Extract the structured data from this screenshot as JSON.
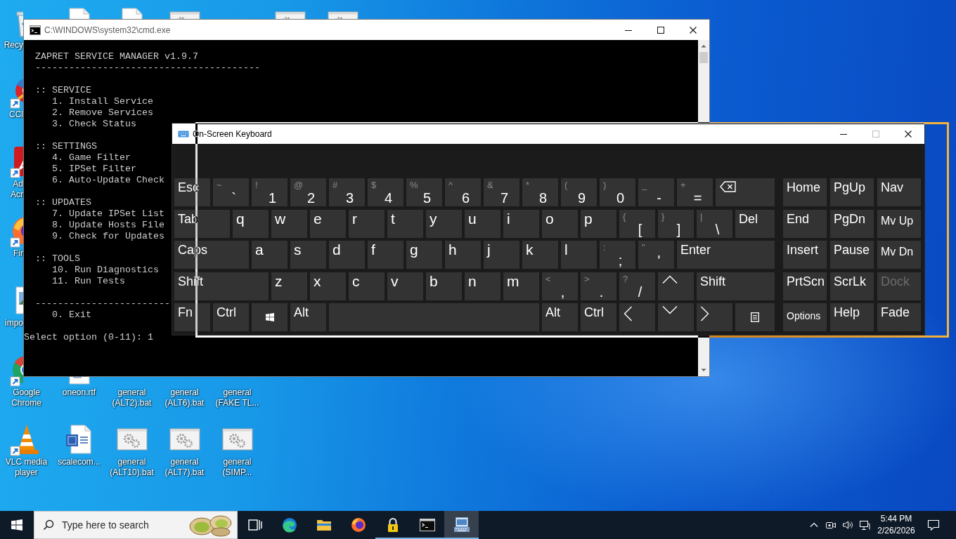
{
  "desktop": {
    "icons": [
      {
        "kind": "bin",
        "label": "Recy"
      },
      {
        "kind": "cleaner",
        "label": "CCl"
      },
      {
        "kind": "pdf",
        "label": "Ad Acr"
      },
      {
        "kind": "fox",
        "label": "Fir"
      },
      {
        "kind": "image",
        "label": "impo"
      },
      {
        "kind": "chrome",
        "label": "Google Chrome"
      },
      {
        "kind": "cone",
        "label": "VLC media player"
      },
      {
        "kind": "document"
      },
      {
        "kind": "document",
        "label": "oneon.rtf"
      },
      {
        "kind": "word",
        "label": "scalecom..."
      },
      {
        "kind": "document"
      },
      {
        "kind": "batch",
        "label": "general (ALT2).bat"
      },
      {
        "kind": "batch",
        "label": "general (ALT10).bat"
      },
      {
        "kind": "batch"
      },
      {
        "kind": "batch",
        "label": "general (ALT6).bat"
      },
      {
        "kind": "batch",
        "label": "general (ALT7).bat"
      },
      {
        "kind": "batch",
        "label": "general (FAKE TL..."
      },
      {
        "kind": "batch",
        "label": "general (SIMP..."
      },
      {
        "kind": "batch"
      },
      {
        "kind": "batch"
      }
    ]
  },
  "terminal_window": {
    "title": "C:\\WINDOWS\\system32\\cmd.exe",
    "controls": [
      {
        "kind": "minimize",
        "disabled": false
      },
      {
        "kind": "maximize",
        "disabled": false
      },
      {
        "kind": "close",
        "disabled": false
      }
    ],
    "console": {
      "header": "ZAPRET SERVICE MANAGER v1.9.7",
      "rule": "----------------------------------------",
      "sections": [
        {
          "heading": ":: SERVICE",
          "items": [
            "1. Install Service",
            "2. Remove Services",
            "3. Check Status"
          ]
        },
        {
          "heading": ":: SETTINGS",
          "items": [
            "4. Game Filter",
            "5. IPSet Filter",
            "6. Auto-Update Check"
          ]
        },
        {
          "heading": ":: UPDATES",
          "items": [
            "7. Update IPSet List",
            "8. Update Hosts File",
            "9. Check for Updates"
          ]
        },
        {
          "heading": ":: TOOLS",
          "items": [
            "10. Run Diagnostics",
            "11. Run Tests"
          ]
        }
      ],
      "footer_rule": "------------------------",
      "exit_item": "0. Exit",
      "prompt": "Select option (0-11): 1"
    }
  },
  "keyboard_window": {
    "title": "On-Screen Keyboard",
    "dragging": true,
    "controls": [
      {
        "kind": "minimize",
        "disabled": false
      },
      {
        "kind": "maximize",
        "disabled": true
      },
      {
        "kind": "close",
        "disabled": false
      }
    ],
    "main_rows": [
      [
        {
          "kind": "text",
          "label": "Esc"
        },
        {
          "kind": "dual",
          "shift": "~",
          "label": "`"
        },
        {
          "kind": "dual",
          "shift": "!",
          "label": "1"
        },
        {
          "kind": "dual",
          "shift": "@",
          "label": "2"
        },
        {
          "kind": "dual",
          "shift": "#",
          "label": "3"
        },
        {
          "kind": "dual",
          "shift": "$",
          "label": "4"
        },
        {
          "kind": "dual",
          "shift": "%",
          "label": "5"
        },
        {
          "kind": "dual",
          "shift": "^",
          "label": "6"
        },
        {
          "kind": "dual",
          "shift": "&",
          "label": "7"
        },
        {
          "kind": "dual",
          "shift": "*",
          "label": "8"
        },
        {
          "kind": "dual",
          "shift": "(",
          "label": "9"
        },
        {
          "kind": "dual",
          "shift": ")",
          "label": "0"
        },
        {
          "kind": "dual",
          "shift": "_",
          "label": "-"
        },
        {
          "kind": "dual",
          "shift": "+",
          "label": "="
        },
        {
          "kind": "backspace"
        }
      ],
      [
        {
          "kind": "text",
          "label": "Tab"
        },
        {
          "kind": "letter",
          "label": "q"
        },
        {
          "kind": "letter",
          "label": "w"
        },
        {
          "kind": "letter",
          "label": "e"
        },
        {
          "kind": "letter",
          "label": "r"
        },
        {
          "kind": "letter",
          "label": "t"
        },
        {
          "kind": "letter",
          "label": "y"
        },
        {
          "kind": "letter",
          "label": "u"
        },
        {
          "kind": "letter",
          "label": "i"
        },
        {
          "kind": "letter",
          "label": "o"
        },
        {
          "kind": "letter",
          "label": "p"
        },
        {
          "kind": "dual",
          "shift": "{",
          "label": "["
        },
        {
          "kind": "dual",
          "shift": "}",
          "label": "]"
        },
        {
          "kind": "dual",
          "shift": "|",
          "label": "\\"
        },
        {
          "kind": "text",
          "label": "Del"
        }
      ],
      [
        {
          "kind": "text",
          "label": "Caps"
        },
        {
          "kind": "letter",
          "label": "a"
        },
        {
          "kind": "letter",
          "label": "s"
        },
        {
          "kind": "letter",
          "label": "d"
        },
        {
          "kind": "letter",
          "label": "f"
        },
        {
          "kind": "letter",
          "label": "g"
        },
        {
          "kind": "letter",
          "label": "h"
        },
        {
          "kind": "letter",
          "label": "j"
        },
        {
          "kind": "letter",
          "label": "k"
        },
        {
          "kind": "letter",
          "label": "l"
        },
        {
          "kind": "dual",
          "shift": ":",
          "label": ";"
        },
        {
          "kind": "dual",
          "shift": "\"",
          "label": "'"
        },
        {
          "kind": "text",
          "label": "Enter"
        }
      ],
      [
        {
          "kind": "text",
          "label": "Shift"
        },
        {
          "kind": "letter",
          "label": "z"
        },
        {
          "kind": "letter",
          "label": "x"
        },
        {
          "kind": "letter",
          "label": "c"
        },
        {
          "kind": "letter",
          "label": "v"
        },
        {
          "kind": "letter",
          "label": "b"
        },
        {
          "kind": "letter",
          "label": "n"
        },
        {
          "kind": "letter",
          "label": "m"
        },
        {
          "kind": "dual",
          "shift": "<",
          "label": ","
        },
        {
          "kind": "dual",
          "shift": ">",
          "label": "."
        },
        {
          "kind": "dual",
          "shift": "?",
          "label": "/"
        },
        {
          "kind": "up"
        },
        {
          "kind": "text",
          "label": "Shift"
        }
      ],
      [
        {
          "kind": "text",
          "label": "Fn"
        },
        {
          "kind": "text",
          "label": "Ctrl"
        },
        {
          "kind": "windows"
        },
        {
          "kind": "text",
          "label": "Alt"
        },
        {
          "kind": "space"
        },
        {
          "kind": "text",
          "label": "Alt"
        },
        {
          "kind": "text",
          "label": "Ctrl"
        },
        {
          "kind": "left"
        },
        {
          "kind": "down"
        },
        {
          "kind": "right"
        },
        {
          "kind": "menu"
        }
      ]
    ],
    "side_rows": [
      [
        {
          "kind": "text",
          "label": "Home",
          "disabled": false
        },
        {
          "kind": "text",
          "label": "PgUp",
          "disabled": false
        },
        {
          "kind": "text",
          "label": "Nav",
          "disabled": false
        }
      ],
      [
        {
          "kind": "text",
          "label": "End",
          "disabled": false
        },
        {
          "kind": "text",
          "label": "PgDn",
          "disabled": false
        },
        {
          "kind": "compact",
          "label": "Mv Up",
          "disabled": false
        }
      ],
      [
        {
          "kind": "text",
          "label": "Insert",
          "disabled": false
        },
        {
          "kind": "text",
          "label": "Pause",
          "disabled": false
        },
        {
          "kind": "compact",
          "label": "Mv Dn",
          "disabled": false
        }
      ],
      [
        {
          "kind": "text",
          "label": "PrtScn",
          "disabled": false
        },
        {
          "kind": "text",
          "label": "ScrLk",
          "disabled": false
        },
        {
          "kind": "text",
          "label": "Dock",
          "disabled": true
        }
      ],
      [
        {
          "kind": "small",
          "label": "Options",
          "disabled": false
        },
        {
          "kind": "text",
          "label": "Help",
          "disabled": false
        },
        {
          "kind": "text",
          "label": "Fade",
          "disabled": false
        }
      ]
    ]
  },
  "taskbar": {
    "search": {
      "placeholder": "Type here to search"
    },
    "apps": [
      {
        "kind": "taskview",
        "running": false,
        "selected": false
      },
      {
        "kind": "edge",
        "running": false,
        "selected": false
      },
      {
        "kind": "folder",
        "running": false,
        "selected": false
      },
      {
        "kind": "fox",
        "running": false,
        "selected": false
      },
      {
        "kind": "padlock",
        "running": true,
        "selected": false
      },
      {
        "kind": "terminal",
        "running": true,
        "selected": false
      },
      {
        "kind": "keyboard",
        "running": true,
        "selected": true
      }
    ],
    "tray": [
      {
        "kind": "chevron"
      },
      {
        "kind": "camera"
      },
      {
        "kind": "volume"
      },
      {
        "kind": "network"
      }
    ],
    "clock": {
      "time": "5:44 PM",
      "date": "2/26/2026"
    }
  }
}
